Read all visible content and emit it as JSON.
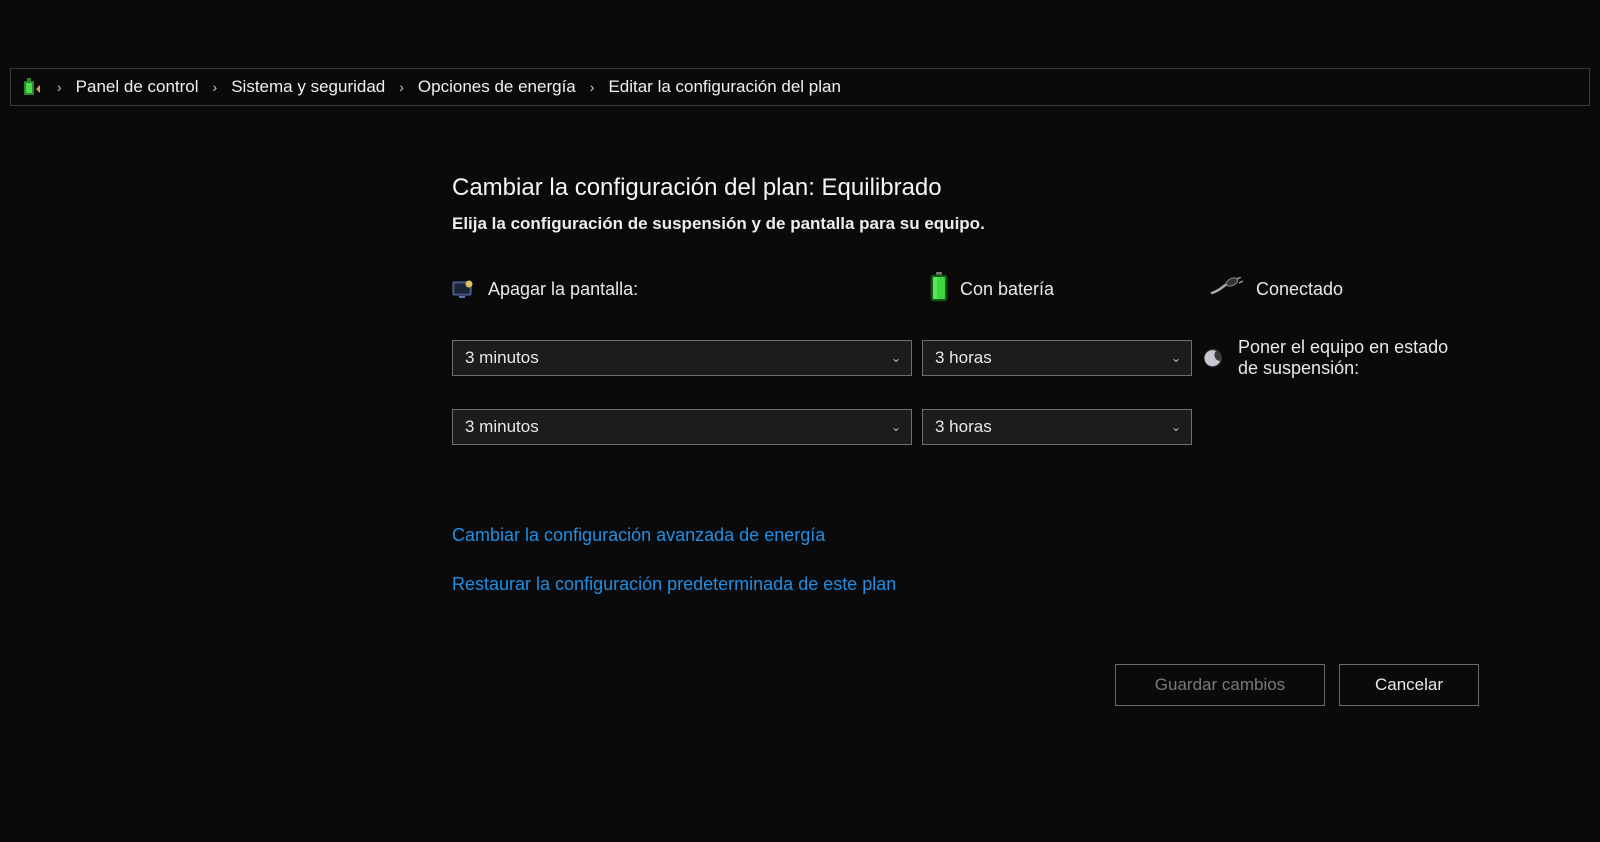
{
  "breadcrumb": {
    "items": [
      "Panel de control",
      "Sistema y seguridad",
      "Opciones de energía",
      "Editar la configuración del plan"
    ]
  },
  "page": {
    "title": "Cambiar la configuración del plan: Equilibrado",
    "subtitle": "Elija la configuración de suspensión y de pantalla para su equipo."
  },
  "columns": {
    "battery": "Con batería",
    "plugged": "Conectado"
  },
  "rows": {
    "display_off": {
      "label": "Apagar la pantalla:",
      "battery_value": "3 minutos",
      "plugged_value": "3 horas"
    },
    "sleep": {
      "label": "Poner el equipo en estado de suspensión:",
      "battery_value": "3 minutos",
      "plugged_value": "3 horas"
    }
  },
  "links": {
    "advanced": "Cambiar la configuración avanzada de energía",
    "restore": "Restaurar la configuración predeterminada de este plan"
  },
  "buttons": {
    "save": "Guardar cambios",
    "cancel": "Cancelar"
  }
}
